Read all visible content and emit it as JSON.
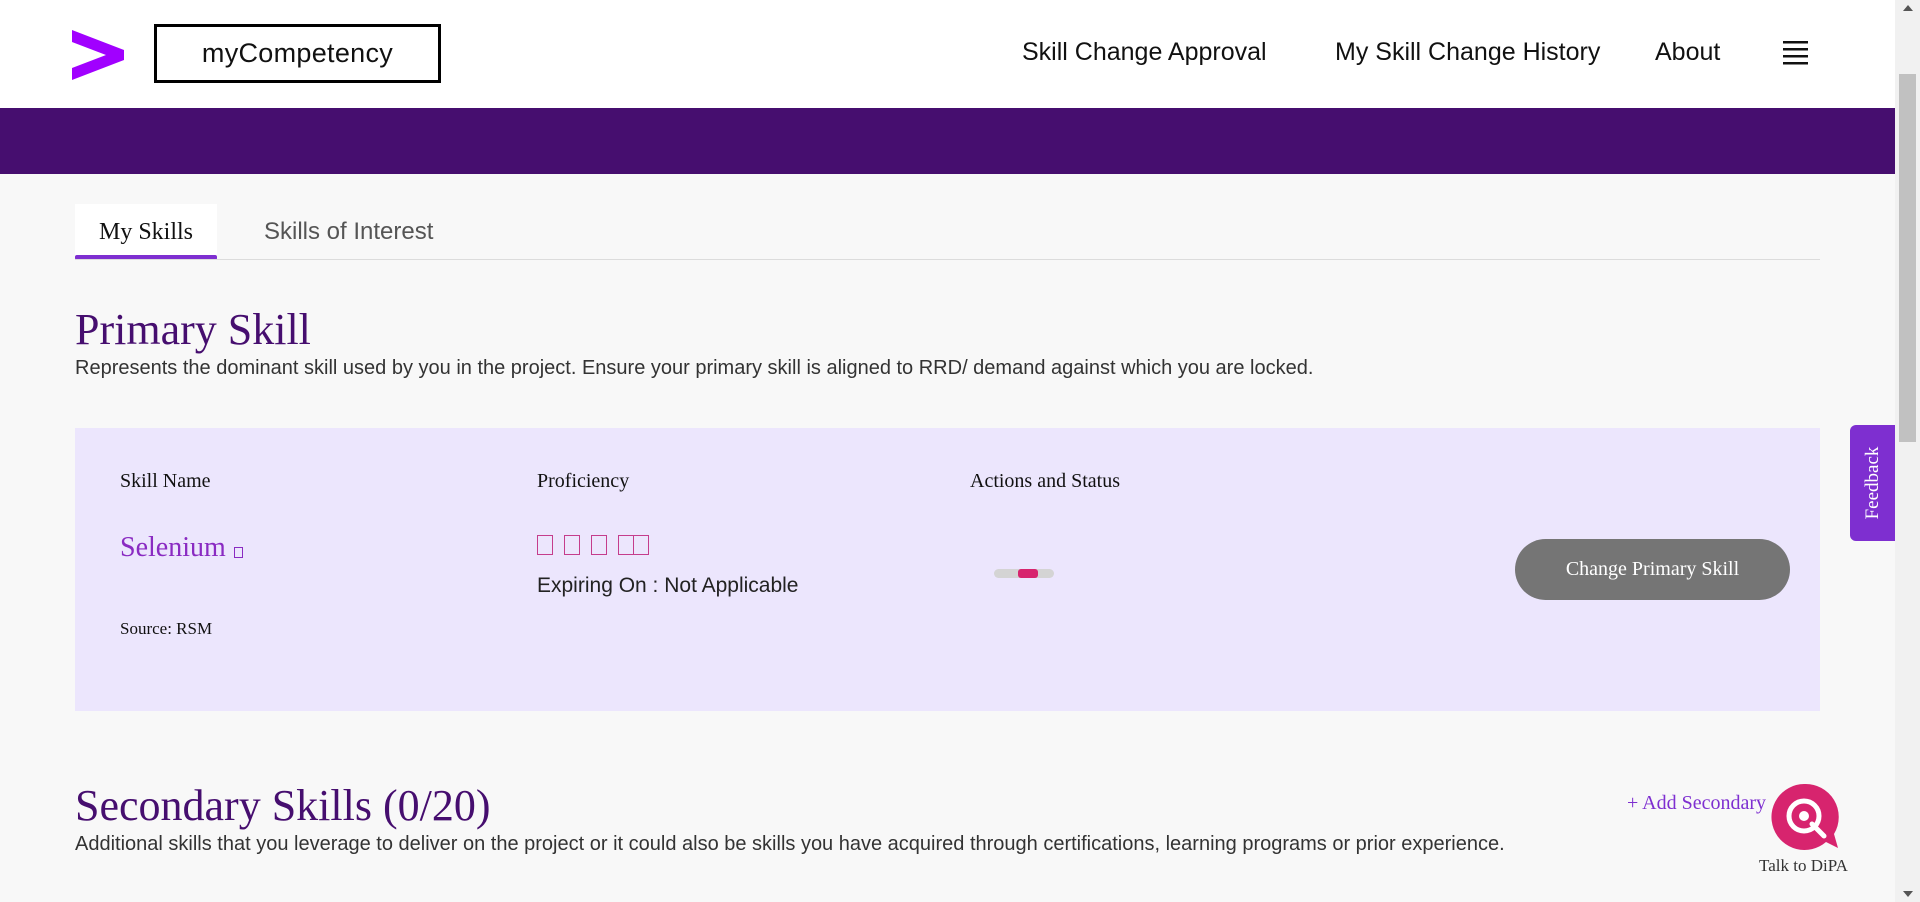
{
  "header": {
    "logo": "accenture-chevron-icon",
    "app_title": "myCompetency",
    "nav": {
      "approval": "Skill Change Approval",
      "history": "My Skill Change History",
      "about": "About"
    },
    "menu_icon": "hamburger-menu-icon"
  },
  "tabs": [
    {
      "label": "My Skills",
      "active": true
    },
    {
      "label": "Skills of Interest",
      "active": false
    }
  ],
  "primary": {
    "title": "Primary Skill",
    "description": "Represents the dominant skill used by you in the project. Ensure your primary skill is aligned to RRD/ demand against which you are locked.",
    "columns": {
      "skill_name": "Skill Name",
      "proficiency": "Proficiency",
      "actions": "Actions and Status"
    },
    "skill": {
      "name": "Selenium",
      "source": "Source: RSM",
      "expiry": "Expiring On : Not Applicable",
      "change_button": "Change Primary Skill"
    }
  },
  "secondary": {
    "title": "Secondary Skills (0/20)",
    "description": "Additional skills that you leverage to deliver on the project or it could also be skills you have acquired through certifications, learning programs or prior experience.",
    "add_label": "+ Add Secondary"
  },
  "feedback_label": "Feedback",
  "dipa_label": "Talk to DiPA",
  "colors": {
    "brand_purple": "#460e6f",
    "accent_purple": "#7e2fd0",
    "card_bg": "#ece6fd",
    "button_gray": "#757575",
    "dipa_pink": "#d7246e"
  }
}
